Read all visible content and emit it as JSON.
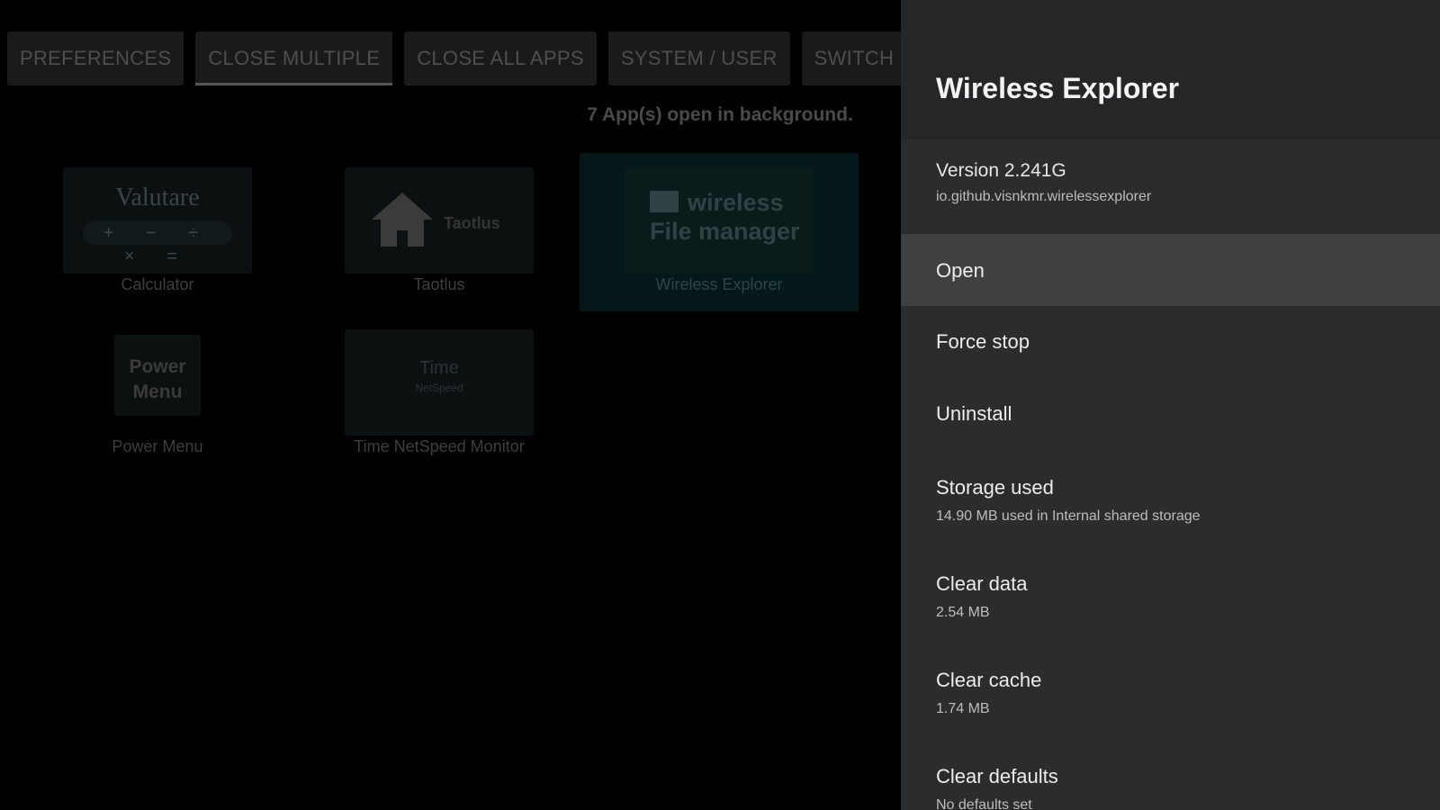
{
  "tabs": [
    {
      "label": "PREFERENCES",
      "active": false
    },
    {
      "label": "CLOSE MULTIPLE",
      "active": true
    },
    {
      "label": "CLOSE ALL APPS",
      "active": false
    },
    {
      "label": "SYSTEM / USER",
      "active": false
    },
    {
      "label": "SWITCH U",
      "active": false
    }
  ],
  "background": {
    "status": "7 App(s) open in background.",
    "apps": [
      {
        "name": "Calculator",
        "thumb_title": "Valutare",
        "thumb_keys": "+ − ÷ × ="
      },
      {
        "name": "Taotlus",
        "thumb_title": "Taotlus"
      },
      {
        "name": "Wireless Explorer",
        "thumb_line1": "wireless",
        "thumb_line2": "File manager",
        "selected": true
      },
      {
        "name": "Power Menu",
        "thumb_line1": "Power",
        "thumb_line2": "Menu"
      },
      {
        "name": "Time NetSpeed Monitor",
        "thumb_title": "Time",
        "thumb_sub": "NetSpeed"
      }
    ]
  },
  "panel": {
    "title": "Wireless Explorer",
    "version": "Version 2.241G",
    "package": "io.github.visnkmr.wirelessexplorer",
    "items": [
      {
        "label": "Open",
        "sub": "",
        "focused": true
      },
      {
        "label": "Force stop",
        "sub": ""
      },
      {
        "label": "Uninstall",
        "sub": ""
      },
      {
        "label": "Storage used",
        "sub": "14.90 MB used in Internal shared storage"
      },
      {
        "label": "Clear data",
        "sub": "2.54 MB"
      },
      {
        "label": "Clear cache",
        "sub": "1.74 MB"
      },
      {
        "label": "Clear defaults",
        "sub": "No defaults set"
      }
    ]
  },
  "colors": {
    "panel_bg": "#2b2c2e",
    "panel_header_bg": "#252628",
    "focused_item_bg": "#3f4042",
    "selected_tile_bg": "#051819"
  },
  "icons": {
    "taotlus": "home-icon",
    "wireless": "folder-icon"
  }
}
